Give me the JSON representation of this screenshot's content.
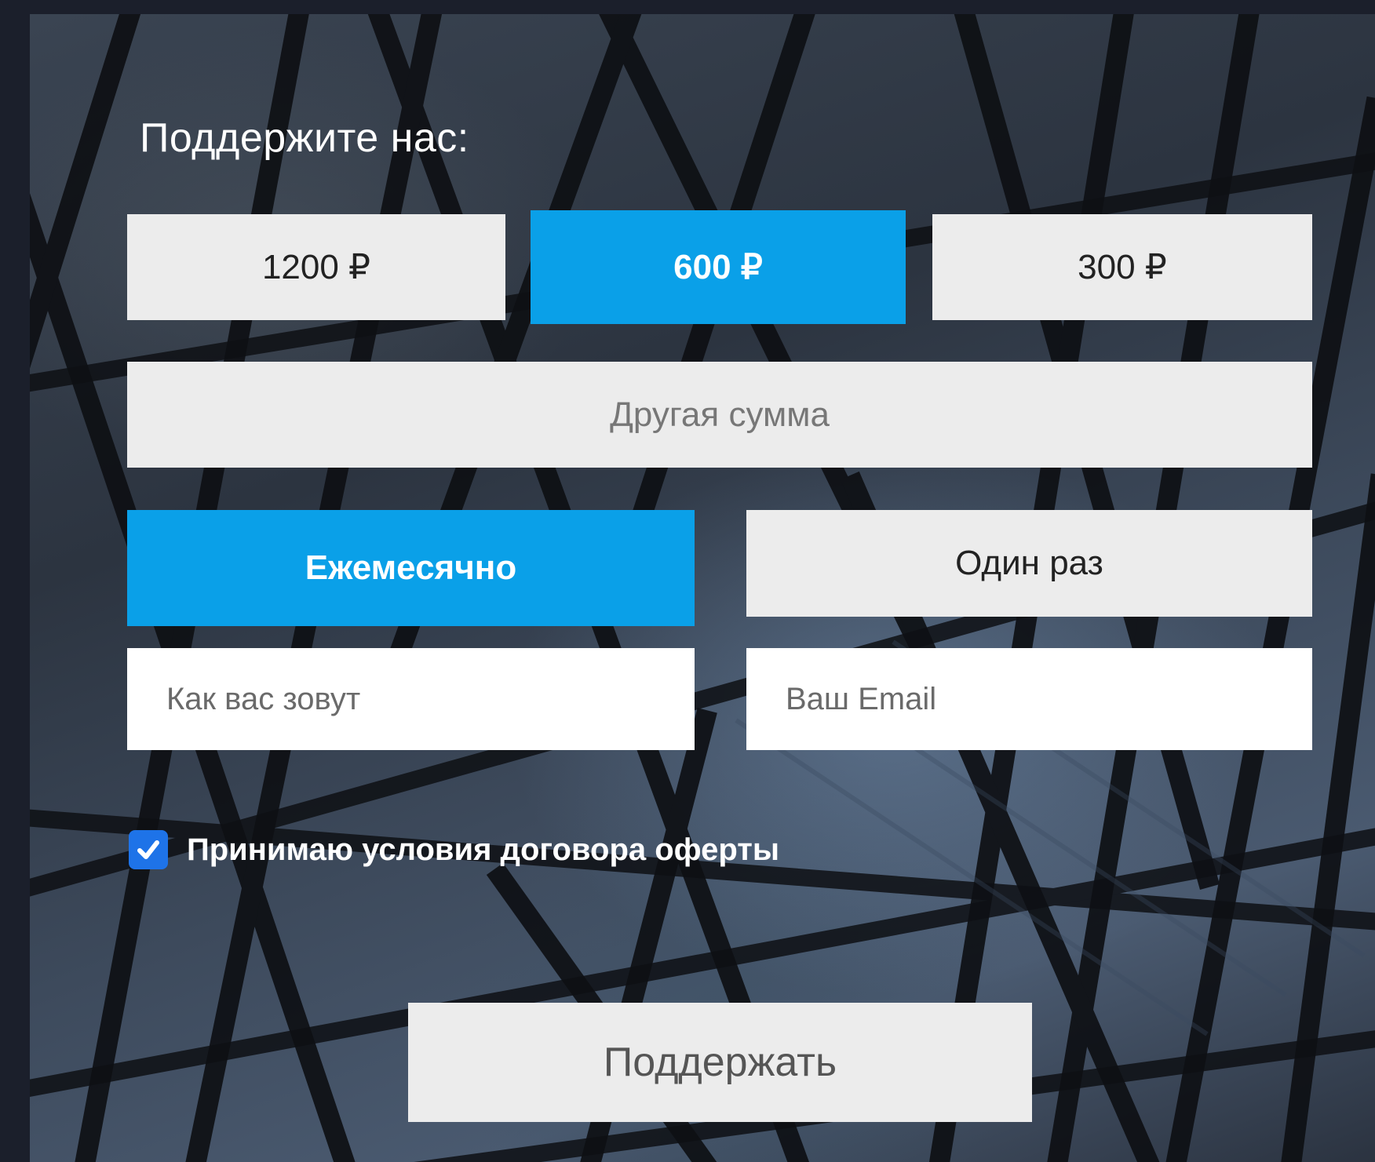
{
  "form": {
    "title": "Поддержите нас:",
    "amounts": [
      {
        "label": "1200 ₽",
        "selected": false
      },
      {
        "label": "600 ₽",
        "selected": true
      },
      {
        "label": "300 ₽",
        "selected": false
      }
    ],
    "other_amount_placeholder": "Другая сумма",
    "frequency": {
      "monthly_label": "Ежемесячно",
      "once_label": "Один раз",
      "selected": "monthly"
    },
    "name_placeholder": "Как вас зовут",
    "email_placeholder": "Ваш Email",
    "agreement": {
      "label": "Принимаю условия договора оферты",
      "checked": true
    },
    "submit_label": "Поддержать"
  },
  "colors": {
    "accent": "#0aa0e8",
    "button_bg": "#ececec",
    "checkbox": "#1e73e8",
    "outer_frame": "#1b1f2b"
  },
  "icons": {
    "checkbox": "checkmark-icon"
  }
}
